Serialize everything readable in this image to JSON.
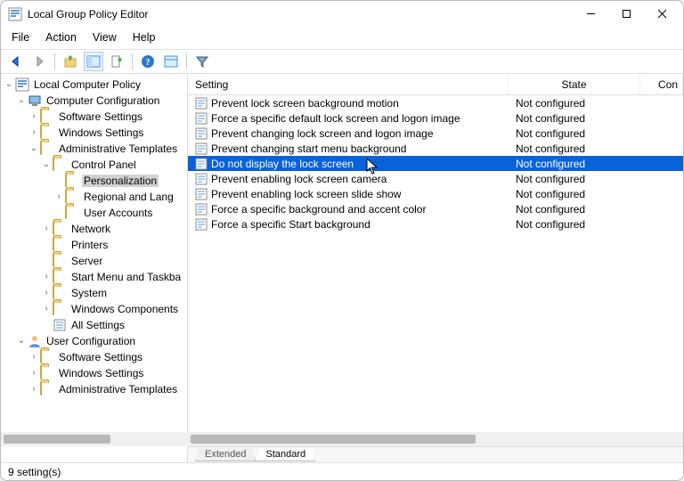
{
  "window": {
    "title": "Local Group Policy Editor"
  },
  "menubar": [
    "File",
    "Action",
    "View",
    "Help"
  ],
  "tree": {
    "root": "Local Computer Policy",
    "nodes": [
      {
        "label": "Computer Configuration",
        "icon": "computer",
        "depth": 1,
        "tw": "v"
      },
      {
        "label": "Software Settings",
        "icon": "folder",
        "depth": 2,
        "tw": ">"
      },
      {
        "label": "Windows Settings",
        "icon": "folder",
        "depth": 2,
        "tw": ">"
      },
      {
        "label": "Administrative Templates",
        "icon": "folder",
        "depth": 2,
        "tw": "v"
      },
      {
        "label": "Control Panel",
        "icon": "folder",
        "depth": 3,
        "tw": "v"
      },
      {
        "label": "Personalization",
        "icon": "folder",
        "depth": 4,
        "tw": "",
        "selected": true
      },
      {
        "label": "Regional and Lang",
        "icon": "folder",
        "depth": 4,
        "tw": ">"
      },
      {
        "label": "User Accounts",
        "icon": "folder",
        "depth": 4,
        "tw": ""
      },
      {
        "label": "Network",
        "icon": "folder",
        "depth": 3,
        "tw": ">"
      },
      {
        "label": "Printers",
        "icon": "folder",
        "depth": 3,
        "tw": ""
      },
      {
        "label": "Server",
        "icon": "folder",
        "depth": 3,
        "tw": ""
      },
      {
        "label": "Start Menu and Taskba",
        "icon": "folder",
        "depth": 3,
        "tw": ">"
      },
      {
        "label": "System",
        "icon": "folder",
        "depth": 3,
        "tw": ">"
      },
      {
        "label": "Windows Components",
        "icon": "folder",
        "depth": 3,
        "tw": ">"
      },
      {
        "label": "All Settings",
        "icon": "allsettings",
        "depth": 3,
        "tw": ""
      },
      {
        "label": "User Configuration",
        "icon": "user",
        "depth": 1,
        "tw": "v"
      },
      {
        "label": "Software Settings",
        "icon": "folder",
        "depth": 2,
        "tw": ">"
      },
      {
        "label": "Windows Settings",
        "icon": "folder",
        "depth": 2,
        "tw": ">"
      },
      {
        "label": "Administrative Templates",
        "icon": "folder",
        "depth": 2,
        "tw": ">"
      }
    ]
  },
  "columns": {
    "name": "Setting",
    "state": "State",
    "comment": "Con"
  },
  "rows": [
    {
      "name": "Prevent lock screen background motion",
      "state": "Not configured"
    },
    {
      "name": "Force a specific default lock screen and logon image",
      "state": "Not configured"
    },
    {
      "name": "Prevent changing lock screen and logon image",
      "state": "Not configured"
    },
    {
      "name": "Prevent changing start menu background",
      "state": "Not configured"
    },
    {
      "name": "Do not display the lock screen",
      "state": "Not configured",
      "selected": true
    },
    {
      "name": "Prevent enabling lock screen camera",
      "state": "Not configured"
    },
    {
      "name": "Prevent enabling lock screen slide show",
      "state": "Not configured"
    },
    {
      "name": "Force a specific background and accent color",
      "state": "Not configured"
    },
    {
      "name": "Force a specific Start background",
      "state": "Not configured"
    }
  ],
  "tabs": {
    "extended": "Extended",
    "standard": "Standard"
  },
  "status": "9 setting(s)"
}
